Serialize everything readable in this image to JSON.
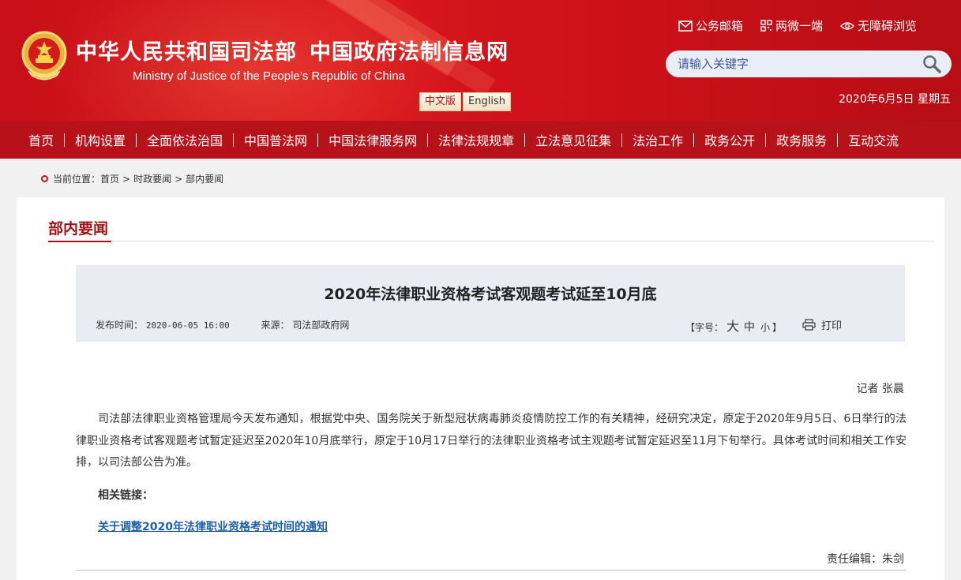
{
  "header": {
    "title_part1": "中华人民共和国司法部",
    "title_part2": "中国政府法制信息网",
    "subtitle": "Ministry of Justice of the People’s Republic of China",
    "lang_cn": "中文版",
    "lang_en": "English",
    "links": [
      {
        "label": "公务邮箱",
        "icon": "mail-icon"
      },
      {
        "label": "两微一端",
        "icon": "qr-icon"
      },
      {
        "label": "无障碍浏览",
        "icon": "eye-icon"
      }
    ],
    "search_placeholder": "请输入关键字",
    "date": "2020年6月5日 星期五"
  },
  "nav": [
    "首页",
    "机构设置",
    "全面依法治国",
    "中国普法网",
    "中国法律服务网",
    "法律法规规章",
    "立法意见征集",
    "法治工作",
    "政务公开",
    "政务服务",
    "互动交流"
  ],
  "breadcrumb": {
    "prefix": "当前位置：",
    "items": [
      "首页",
      "时政要闻",
      "部内要闻"
    ],
    "separator": ">"
  },
  "section": {
    "title": "部内要闻"
  },
  "article": {
    "title": "2020年法律职业资格考试客观题考试延至10月底",
    "publish_label": "发布时间：",
    "publish_time": "2020-06-05 16:00",
    "source_label": "来源：",
    "source": "司法部政府网",
    "fontsize_open": "【字号：",
    "fontsize_big": "大",
    "fontsize_mid": "中",
    "fontsize_small": "小",
    "fontsize_close": "】",
    "print_label": "打印",
    "reporter": "记者 张晨",
    "body": "司法部法律职业资格管理局今天发布通知，根据党中央、国务院关于新型冠状病毒肺炎疫情防控工作的有关精神，经研究决定，原定于2020年9月5日、6日举行的法律职业资格考试客观题考试暂定延迟至2020年10月底举行，原定于10月17日举行的法律职业资格考试主观题考试暂定延迟至11月下旬举行。具体考试时间和相关工作安排，以司法部公告为准。",
    "related_label": "相关链接：",
    "related_link": "关于调整2020年法律职业资格考试时间的通知",
    "editor": "责任编辑：朱剑"
  },
  "colors": {
    "header_red": "#d9161d",
    "nav_red": "#b71119",
    "section_red": "#a51216",
    "link_blue": "#1f5fa8"
  }
}
